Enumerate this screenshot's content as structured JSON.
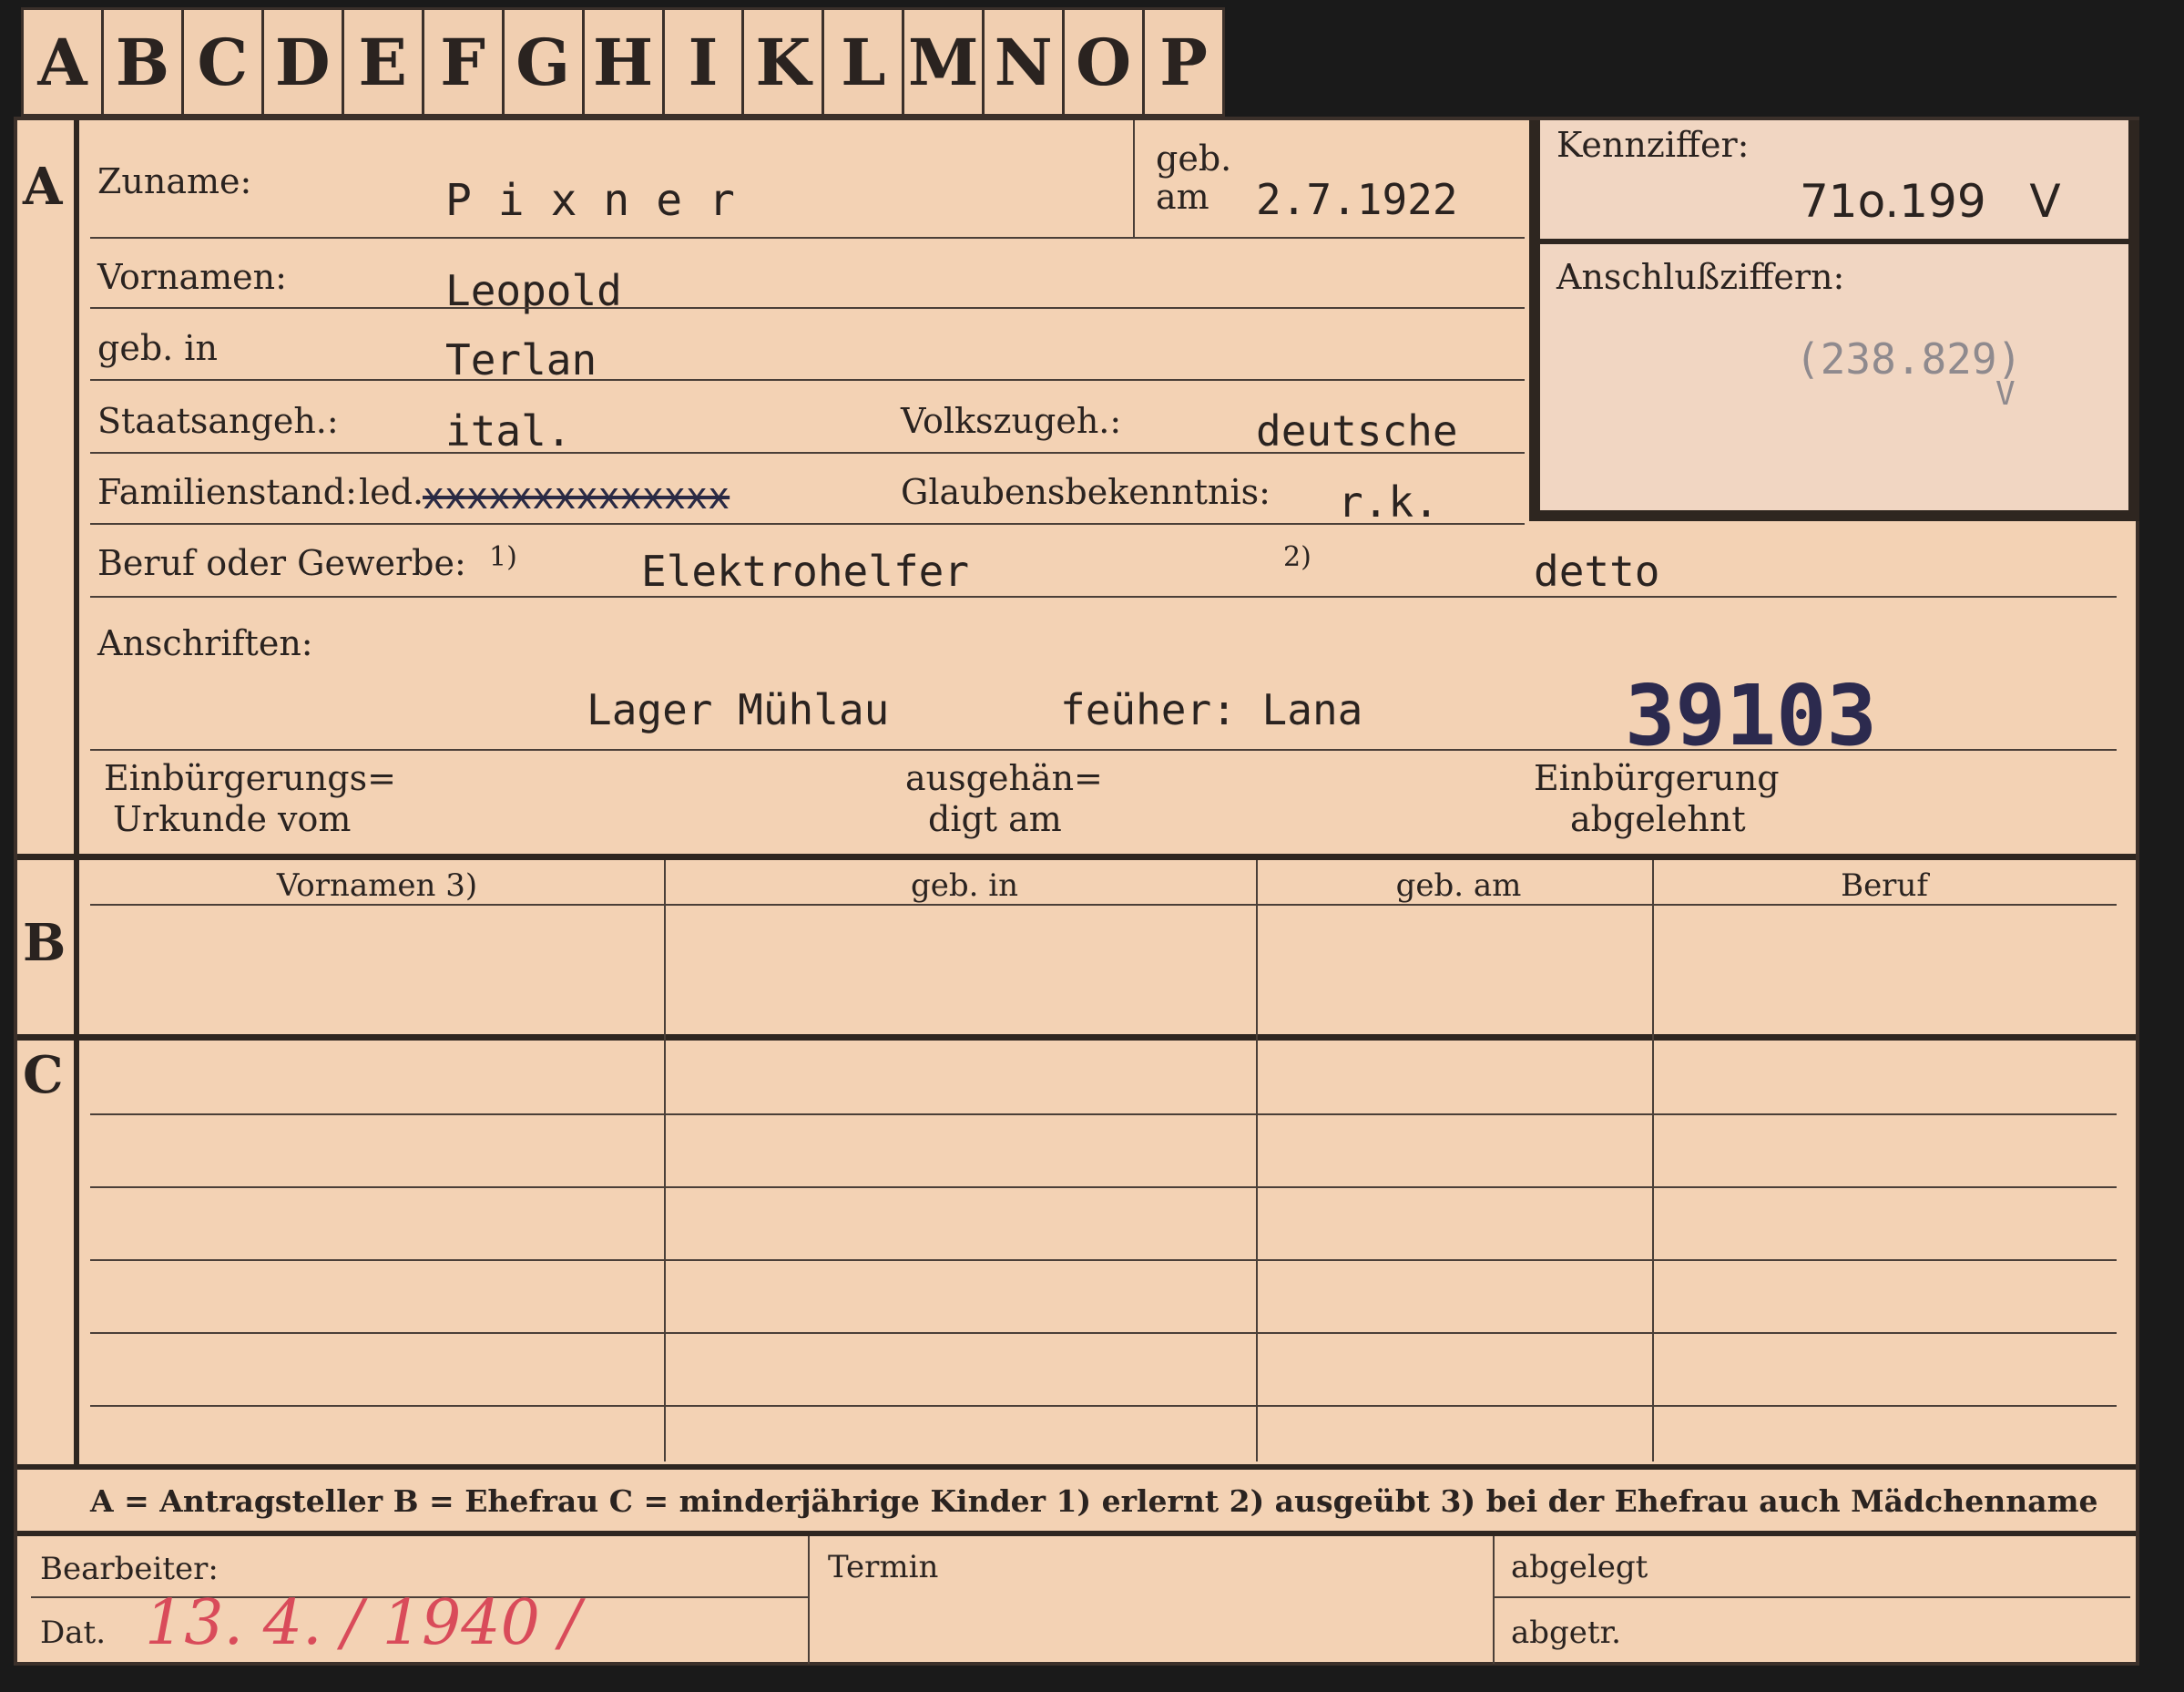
{
  "tabs": [
    "A",
    "B",
    "C",
    "D",
    "E",
    "F",
    "G",
    "H",
    "I",
    "K",
    "L",
    "M",
    "N",
    "O",
    "P"
  ],
  "section_a": {
    "marker": "A",
    "zuname_label": "Zuname:",
    "zuname_value": "P i x n e r",
    "geb_am_label_1": "geb.",
    "geb_am_label_2": "am",
    "geb_am_value": "2.7.1922",
    "kennziffer_label": "Kennziffer:",
    "kennziffer_value": "71o.199   V",
    "anschluss_label": "Anschlußziffern:",
    "anschluss_value": "(238.829)",
    "anschluss_mark": "V",
    "vornamen_label": "Vornamen:",
    "vornamen_value": "Leopold",
    "geb_in_label": "geb. in",
    "geb_in_value": "Terlan",
    "staats_label": "Staatsangeh.:",
    "staats_value": "ital.",
    "volks_label": "Volkszugeh.:",
    "volks_value": "deutsche",
    "familien_label": "Familienstand:",
    "familien_value": "led.",
    "familien_struck": "xxxxxxxxxxxxxx",
    "glaubens_label": "Glaubensbekenntnis:",
    "glaubens_value": "r.k.",
    "beruf_label": "Beruf oder Gewerbe:",
    "beruf_mark_1": "1)",
    "beruf_value_1": "Elektrohelfer",
    "beruf_mark_2": "2)",
    "beruf_value_2": "detto",
    "anschriften_label": "Anschriften:",
    "anschriften_value_1": "Lager Mühlau",
    "anschriften_value_2": "feüher: Lana",
    "stamp_number": "39103",
    "einb_label_1": "Einbürgerungs=",
    "einb_label_2": "Urkunde vom",
    "ausg_label_1": "ausgehän=",
    "ausg_label_2": "digt am",
    "abgelehnt_label_1": "Einbürgerung",
    "abgelehnt_label_2": "abgelehnt"
  },
  "section_b": {
    "marker": "B",
    "columns": [
      "Vornamen 3)",
      "geb. in",
      "geb. am",
      "Beruf"
    ]
  },
  "section_c": {
    "marker": "C"
  },
  "legend": "A = Antragsteller   B = Ehefrau   C = minderjährige Kinder   1) erlernt   2) ausgeübt   3) bei der Ehefrau auch Mädchenname",
  "footer": {
    "bearbeiter_label": "Bearbeiter:",
    "dat_label": "Dat.",
    "dat_value": "13. 4. / 1940 /",
    "termin_label": "Termin",
    "abgelegt_label": "abgelegt",
    "abgetr_label": "abgetr."
  },
  "colors": {
    "card": "#f3d2b4",
    "ink": "#2a2320",
    "stamp": "#2c2a4e",
    "pencil_red": "#d94b5a"
  }
}
